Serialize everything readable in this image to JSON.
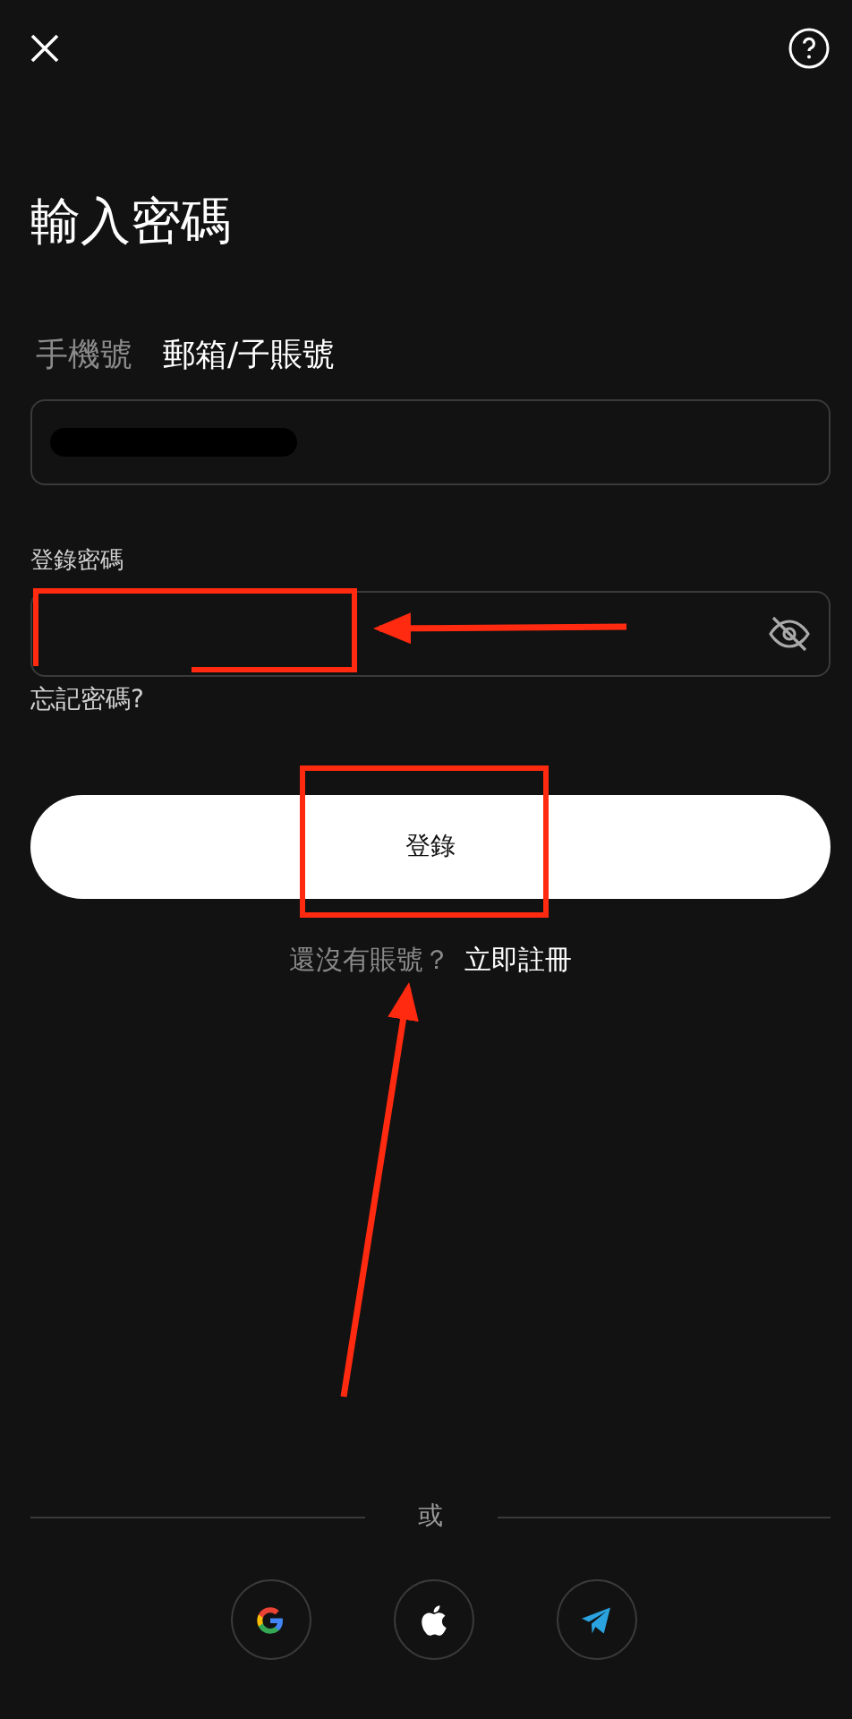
{
  "title": "輸入密碼",
  "tabs": [
    {
      "label": "手機號",
      "selected": false
    },
    {
      "label": "郵箱/子賬號",
      "selected": true
    }
  ],
  "account_field": {
    "redacted": true
  },
  "password": {
    "label": "登錄密碼",
    "visible": false
  },
  "forgot_link": "忘記密碼?",
  "login_button": "登錄",
  "register": {
    "prompt": "還沒有賬號？",
    "link": "立即註冊"
  },
  "divider_text": "或",
  "social": [
    {
      "kind": "google"
    },
    {
      "kind": "apple"
    },
    {
      "kind": "telegram"
    }
  ]
}
